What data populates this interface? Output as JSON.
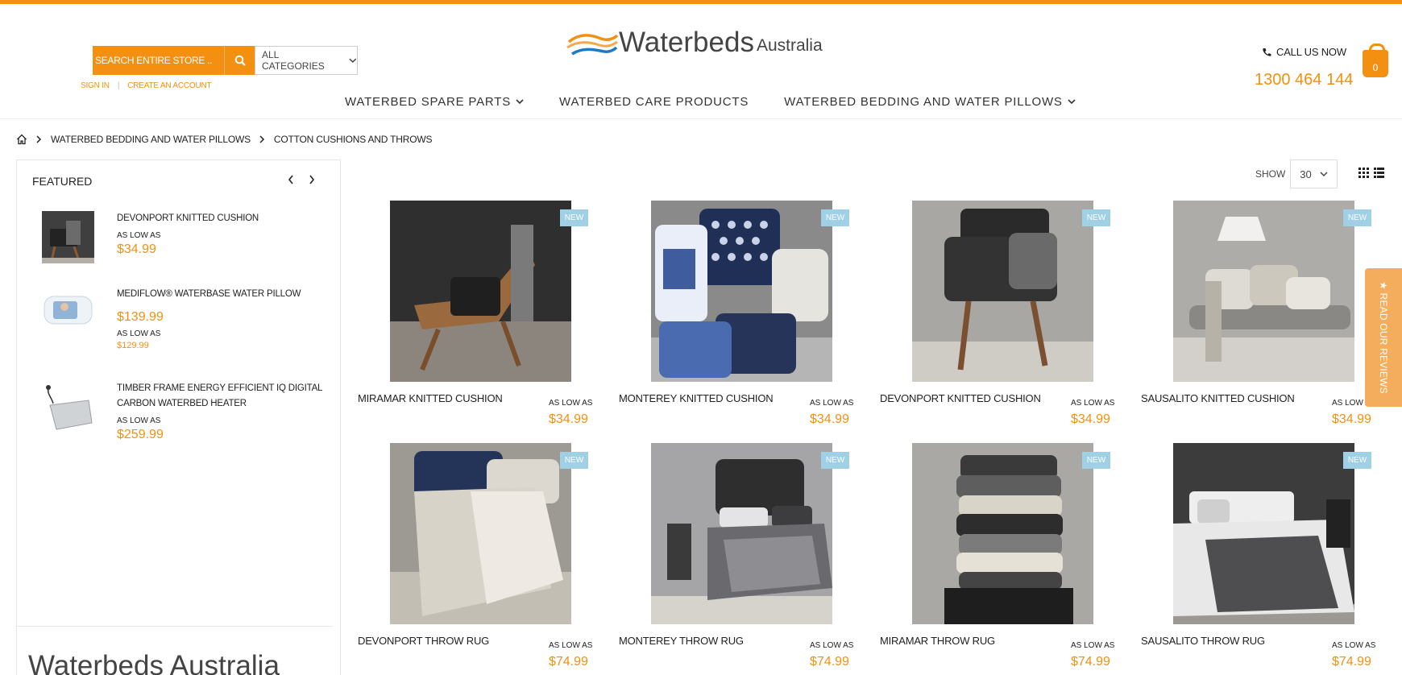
{
  "search": {
    "placeholder": "SEARCH ENTIRE STORE ..",
    "category": "ALL CATEGORIES"
  },
  "account": {
    "sign_in": "SIGN IN",
    "create": "CREATE AN ACCOUNT"
  },
  "logo": {
    "main": "Waterbeds",
    "sub": "Australia"
  },
  "contact": {
    "call_label": "CALL US NOW",
    "phone": "1300 464 144"
  },
  "cart": {
    "count": "0"
  },
  "nav": [
    {
      "label": "WATERBED SPARE PARTS"
    },
    {
      "label": "WATERBED CARE PRODUCTS"
    },
    {
      "label": "WATERBED BEDDING AND WATER PILLOWS"
    }
  ],
  "breadcrumb": {
    "level1": "WATERBED BEDDING AND WATER PILLOWS",
    "level2": "COTTON CUSHIONS AND THROWS"
  },
  "sidebar": {
    "title": "FEATURED",
    "items": [
      {
        "name": "DEVONPORT KNITTED CUSHION",
        "low": "AS LOW AS",
        "price": "$34.99"
      },
      {
        "name": "MEDIFLOW® WATERBASE WATER PILLOW",
        "price": "$139.99",
        "low": "AS LOW AS",
        "price2": "$129.99"
      },
      {
        "name": "TIMBER FRAME ENERGY EFFICIENT IQ DIGITAL CARBON WATERBED HEATER",
        "low": "AS LOW AS",
        "price": "$259.99"
      }
    ],
    "bottom_logo": "Waterbeds Australia"
  },
  "toolbar": {
    "show_label": "SHOW",
    "show_value": "30"
  },
  "products": [
    {
      "name": "MIRAMAR KNITTED CUSHION",
      "badge": "NEW",
      "low": "AS LOW AS",
      "price": "$34.99"
    },
    {
      "name": "MONTEREY KNITTED CUSHION",
      "badge": "NEW",
      "low": "AS LOW AS",
      "price": "$34.99"
    },
    {
      "name": "DEVONPORT KNITTED CUSHION",
      "badge": "NEW",
      "low": "AS LOW AS",
      "price": "$34.99"
    },
    {
      "name": "SAUSALITO KNITTED CUSHION",
      "badge": "NEW",
      "low": "AS LOW AS",
      "price": "$34.99"
    },
    {
      "name": "DEVONPORT THROW RUG",
      "badge": "NEW",
      "low": "AS LOW AS",
      "price": "$74.99"
    },
    {
      "name": "MONTEREY THROW RUG",
      "badge": "NEW",
      "low": "AS LOW AS",
      "price": "$74.99"
    },
    {
      "name": "MIRAMAR THROW RUG",
      "badge": "NEW",
      "low": "AS LOW AS",
      "price": "$74.99"
    },
    {
      "name": "SAUSALITO THROW RUG",
      "badge": "NEW",
      "low": "AS LOW AS",
      "price": "$74.99"
    }
  ],
  "reviews_tab": "★ READ OUR REVIEWS",
  "colors": {
    "accent": "#f39011",
    "badge": "#9fd0e5",
    "reviews": "#f4ad5d"
  }
}
